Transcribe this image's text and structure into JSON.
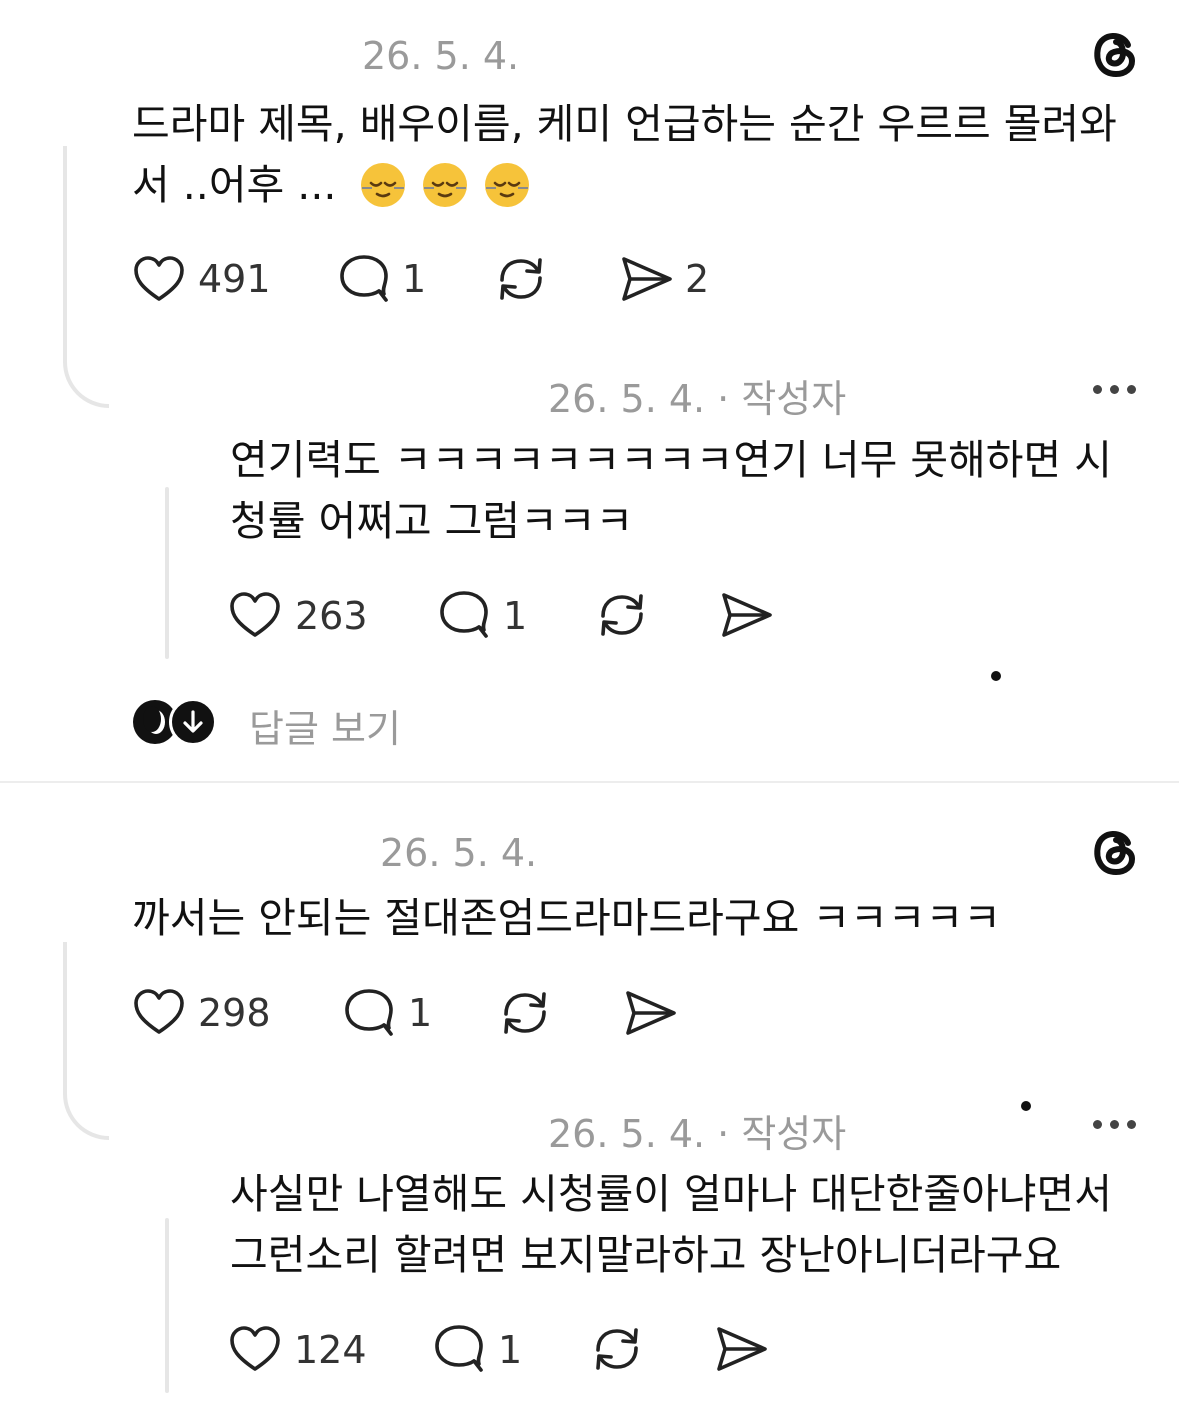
{
  "posts": [
    {
      "date": "26. 5. 4.",
      "text": "드라마 제목, 배우이름, 케미 언급하는 순간 우르르 몰려와서 ..어후 ...",
      "emoji": [
        "relieved-face",
        "relieved-face",
        "relieved-face"
      ],
      "likes": "491",
      "replies": "1",
      "shares": "2",
      "reply": {
        "date": "26. 5. 4. · 작성자",
        "text": "연기력도 ㅋㅋㅋㅋㅋㅋㅋㅋㅋ연기 너무 못해하면 시청률 어쩌고 그럼ㅋㅋㅋ",
        "likes": "263",
        "replies": "1"
      },
      "view_replies": "답글 보기"
    },
    {
      "date": "26. 5. 4.",
      "text": "까서는 안되는 절대존엄드라마드라구요 ㅋㅋㅋㅋㅋ",
      "likes": "298",
      "replies": "1",
      "reply": {
        "date": "26. 5. 4. · 작성자",
        "text": "사실만 나열해도 시청률이 얼마나 대단한줄아냐면서 그런소리 할려면 보지말라하고 장난아니더라구요",
        "likes": "124",
        "replies": "1"
      }
    }
  ],
  "icons": {
    "brand": "threads-logo-icon",
    "like": "heart-icon",
    "reply": "comment-bubble-icon",
    "repost": "repost-icon",
    "share": "send-icon",
    "more": "more-dots-icon",
    "expand": "arrow-down-icon"
  },
  "colors": {
    "text": "#111111",
    "meta": "#9a9a9a",
    "thread_line": "#e6e6e6"
  }
}
